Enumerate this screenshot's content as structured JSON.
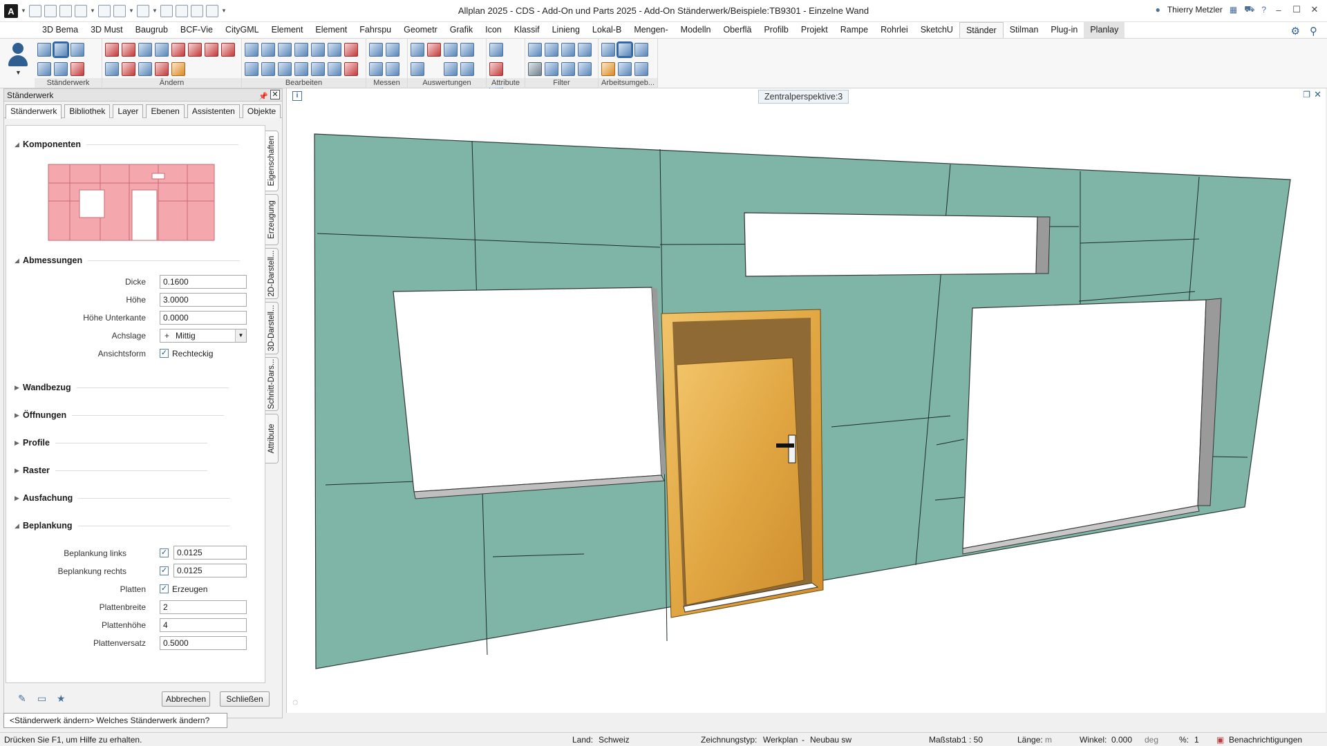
{
  "titlebar": {
    "title": "Allplan 2025 - CDS - Add-On und Parts 2025 - Add-On Ständerwerk/Beispiele:TB9301 - Einzelne Wand",
    "user": "Thierry Metzler",
    "app_logo": "A"
  },
  "menu": {
    "tabs": [
      "3D Bema",
      "3D Must",
      "Baugrub",
      "BCF-Vie",
      "CityGML",
      "Element",
      "Element",
      "Fahrspu",
      "Geometr",
      "Grafik",
      "Icon",
      "Klassif",
      "Linieng",
      "Lokal-B",
      "Mengen-",
      "Modelln",
      "Oberflä",
      "Profilb",
      "Projekt",
      "Rampe",
      "Rohrlei",
      "SketchU",
      "Ständer",
      "Stilman",
      "Plug-in",
      "Planlay"
    ],
    "active": "Ständer"
  },
  "ribbon": {
    "groups": [
      "Ständerwerk",
      "Ändern",
      "Bearbeiten",
      "Messen",
      "Auswertungen",
      "Attribute",
      "Filter",
      "Arbeitsumgeb..."
    ]
  },
  "palette": {
    "title": "Ständerwerk",
    "tabs": [
      "Ständerwerk",
      "Bibliothek",
      "Layer",
      "Ebenen",
      "Assistenten",
      "Objekte"
    ],
    "active_tab": "Ständerwerk",
    "side_tabs": [
      "Eigenschaften",
      "Erzeugung",
      "2D-Darstell...",
      "3D-Darstell...",
      "Schnitt-Dars...",
      "Attribute"
    ],
    "sections": {
      "komponenten": "Komponenten",
      "abmessungen": "Abmessungen",
      "wandbezug": "Wandbezug",
      "oeffnungen": "Öffnungen",
      "profile": "Profile",
      "raster": "Raster",
      "ausfachung": "Ausfachung",
      "beplankung": "Beplankung"
    },
    "abmessungen": {
      "dicke_label": "Dicke",
      "dicke": "0.1600",
      "hoehe_label": "Höhe",
      "hoehe": "3.0000",
      "hoehe_uk_label": "Höhe Unterkante",
      "hoehe_uk": "0.0000",
      "achslage_label": "Achslage",
      "achslage": "Mittig",
      "ansichtsform_label": "Ansichtsform",
      "ansichtsform": "Rechteckig"
    },
    "beplankung": {
      "links_label": "Beplankung links",
      "links": "0.0125",
      "rechts_label": "Beplankung rechts",
      "rechts": "0.0125",
      "platten_label": "Platten",
      "platten": "Erzeugen",
      "plattenbreite_label": "Plattenbreite",
      "plattenbreite": "2",
      "plattenhoehe_label": "Plattenhöhe",
      "plattenhoehe": "4",
      "plattenversatz_label": "Plattenversatz",
      "plattenversatz": "0.5000"
    },
    "buttons": {
      "abbrechen": "Abbrechen",
      "schliessen": "Schließen"
    }
  },
  "command_line": "<Ständerwerk ändern> Welches Ständerwerk ändern?",
  "viewport": {
    "label": "Zentralperspektive:3"
  },
  "statusbar": {
    "hint": "Drücken Sie F1, um Hilfe zu erhalten.",
    "land_label": "Land:",
    "land": "Schweiz",
    "zt_label": "Zeichnungstyp:",
    "zt": "Werkplan",
    "ztsep": "-",
    "zt2": "Neubau sw",
    "massstab_label": "Maßstab:",
    "massstab": "1 : 50",
    "laenge_label": "Länge:",
    "laenge_unit": "m",
    "winkel_label": "Winkel:",
    "winkel": "0.000",
    "winkel_unit": "deg",
    "pct_label": "%:",
    "pct": "1",
    "notify": "Benachrichtigungen"
  },
  "colors": {
    "board": "#7fb5a6",
    "panel_pink": "#f4a7ad",
    "accent": "#2b65a8"
  }
}
